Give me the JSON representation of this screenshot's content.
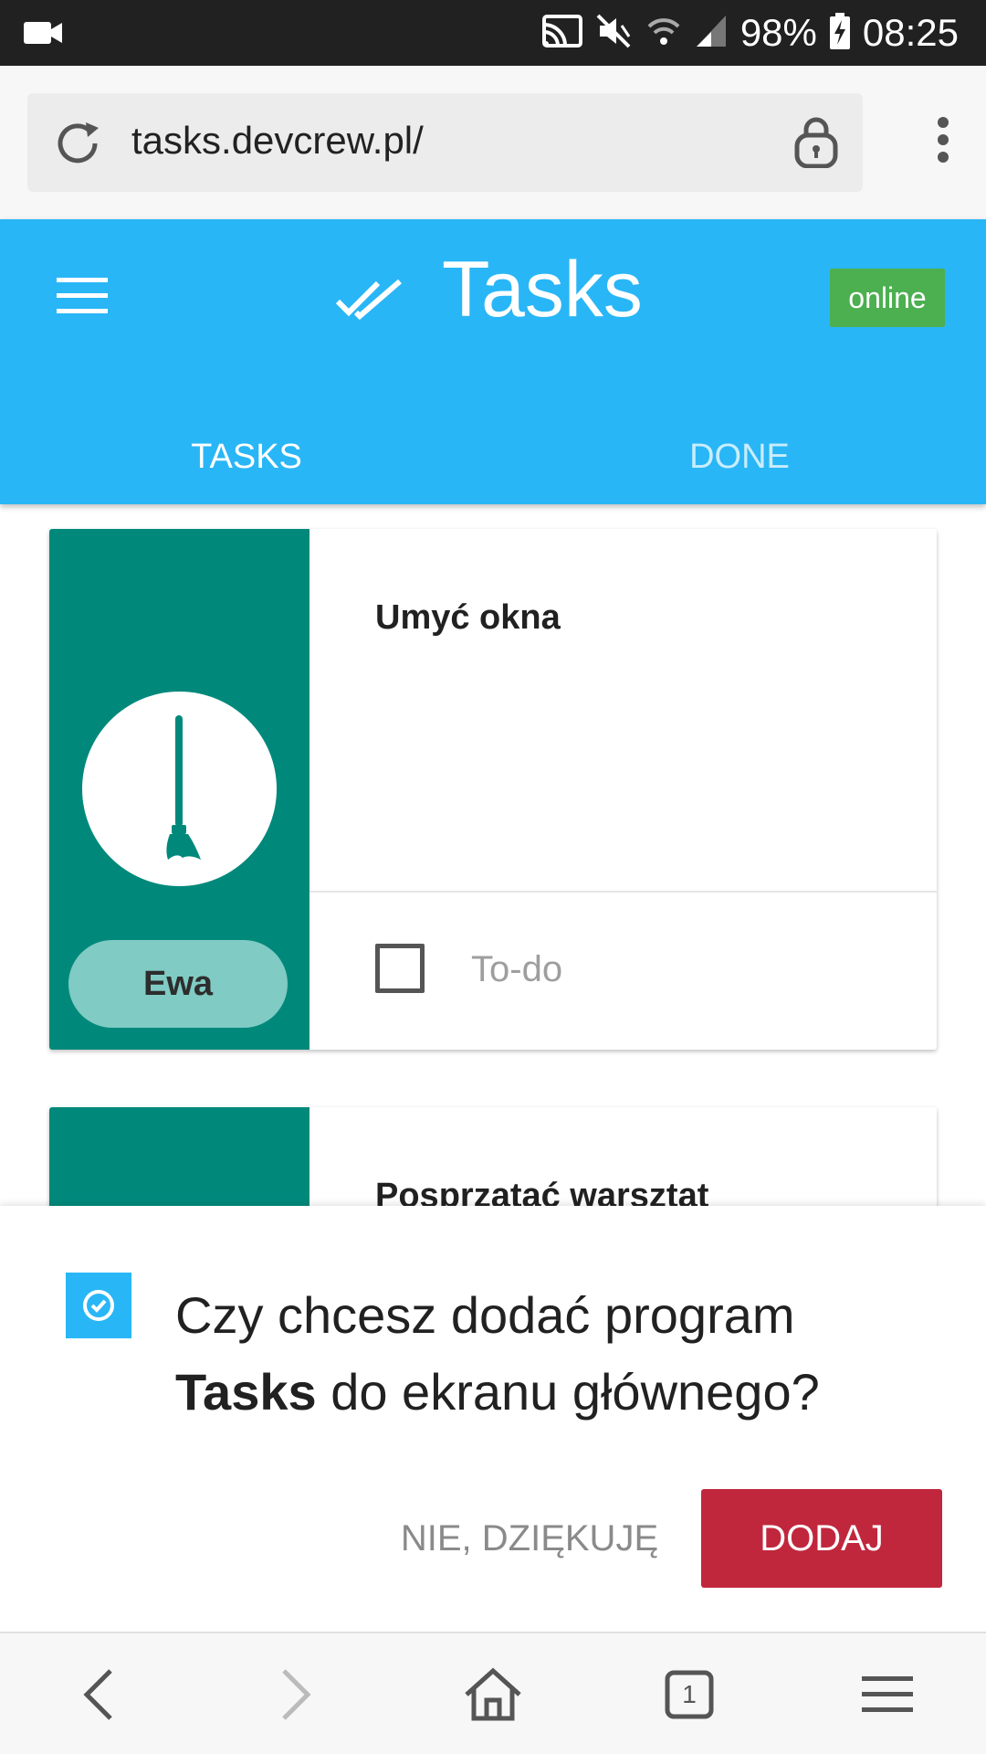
{
  "status_bar": {
    "battery": "98%",
    "time": "08:25"
  },
  "browser": {
    "url": "tasks.devcrew.pl/",
    "tab_count": "1"
  },
  "app": {
    "title": "Tasks",
    "status_badge": "online",
    "tabs": [
      {
        "label": "TASKS",
        "active": true
      },
      {
        "label": "DONE",
        "active": false
      }
    ]
  },
  "tasks": [
    {
      "title": "Umyć okna",
      "assignee": "Ewa",
      "status_label": "To-do",
      "icon": "broom-icon"
    },
    {
      "title": "Posprzątać warsztat"
    }
  ],
  "install_banner": {
    "question_prefix": "Czy chcesz dodać program",
    "app_name": "Tasks",
    "question_suffix": "do ekranu głównego?",
    "decline_label": "NIE, DZIĘKUJĘ",
    "accept_label": "DODAJ"
  },
  "colors": {
    "header": "#29b6f6",
    "card_accent": "#00897b",
    "online": "#4caf50",
    "accept_button": "#c0273d"
  }
}
